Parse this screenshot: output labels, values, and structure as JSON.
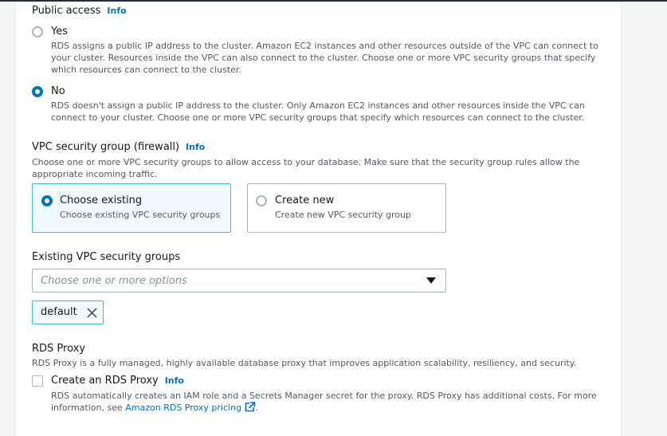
{
  "public_access": {
    "title": "Public access",
    "info": "Info",
    "options": [
      {
        "label": "Yes",
        "selected": false,
        "desc_lines": [
          "RDS assigns a public IP address to the cluster. Amazon EC2 instances and other resources outside of the VPC can connect to",
          "your cluster. Resources inside the VPC can also connect to the cluster. Choose one or more VPC security groups that specify",
          "which resources can connect to the cluster."
        ]
      },
      {
        "label": "No",
        "selected": true,
        "desc_lines": [
          "RDS doesn't assign a public IP address to the cluster. Only Amazon EC2 instances and other resources inside the VPC can",
          "connect to your cluster. Choose one or more VPC security groups that specify which resources can connect to the cluster."
        ]
      }
    ]
  },
  "vpc_sg": {
    "title": "VPC security group (firewall)",
    "info": "Info",
    "desc_lines": [
      "Choose one or more VPC security groups to allow access to your database. Make sure that the security group rules allow the",
      "appropriate incoming traffic."
    ],
    "cards": [
      {
        "label": "Choose existing",
        "desc": "Choose existing VPC security groups",
        "selected": true
      },
      {
        "label": "Create new",
        "desc": "Create new VPC security group",
        "selected": false
      }
    ]
  },
  "existing_sg": {
    "title": "Existing VPC security groups",
    "placeholder": "Choose one or more options",
    "tokens": [
      "default"
    ]
  },
  "rds_proxy": {
    "title": "RDS Proxy",
    "desc": "RDS Proxy is a fully managed, highly available database proxy that improves application scalability, resiliency, and security.",
    "checkbox_label": "Create an RDS Proxy",
    "info": "Info",
    "checked": false,
    "help_line1": "RDS automatically creates an IAM role and a Secrets Manager secret for the proxy. RDS Proxy has additional costs. For more",
    "help_line2_prefix": "information, see ",
    "link_text": "Amazon RDS Proxy pricing",
    "help_line2_suffix": "."
  }
}
